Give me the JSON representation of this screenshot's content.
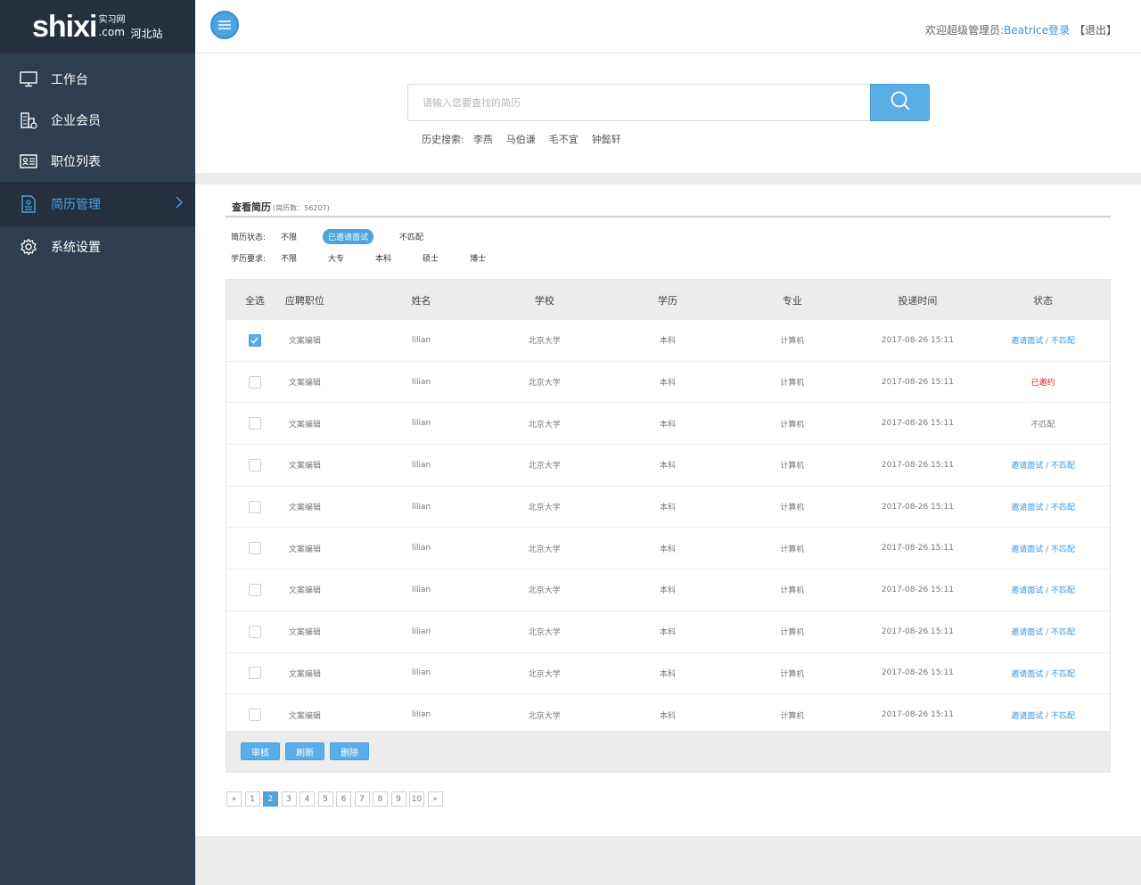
{
  "logo": {
    "main": "shixi",
    "sub_top": "实习网",
    "sub_bottom": ".com",
    "region": "河北站"
  },
  "sidebar": {
    "items": [
      {
        "label": "工作台",
        "icon": "monitor-icon"
      },
      {
        "label": "企业会员",
        "icon": "building-icon"
      },
      {
        "label": "职位列表",
        "icon": "id-card-icon"
      },
      {
        "label": "简历管理",
        "icon": "resume-icon",
        "active": true
      },
      {
        "label": "系统设置",
        "icon": "gear-icon"
      }
    ]
  },
  "header": {
    "welcome_prefix": "欢迎超级管理员:",
    "username": "Beatrice登录",
    "logout": "【退出】"
  },
  "search": {
    "placeholder": "请输入您要查找的简历",
    "history_label": "历史搜索:",
    "history": [
      "李燕",
      "马伯谦",
      "毛不宜",
      "钟懿轩"
    ]
  },
  "section": {
    "title": "查看简历",
    "count": "(简历数：56207)"
  },
  "filters": {
    "status_label": "简历状态:",
    "status_options": [
      "不限",
      "已邀请面试",
      "不匹配"
    ],
    "edu_label": "学历要求:",
    "edu_options": [
      "不限",
      "大专",
      "本科",
      "硕士",
      "博士"
    ]
  },
  "table": {
    "headers": [
      "全选",
      "应聘职位",
      "姓名",
      "学校",
      "学历",
      "专业",
      "投递时间",
      "状态"
    ],
    "rows": [
      {
        "checked": true,
        "position": "文案编辑",
        "name": "lilian",
        "school": "北京大学",
        "edu": "本科",
        "major": "计算机",
        "time": "2017-08-26 15:11",
        "status": "邀请面试 / 不匹配",
        "status_type": "action"
      },
      {
        "checked": false,
        "position": "文案编辑",
        "name": "lilian",
        "school": "北京大学",
        "edu": "本科",
        "major": "计算机",
        "time": "2017-08-26 15:11",
        "status": "已邀约",
        "status_type": "invited"
      },
      {
        "checked": false,
        "position": "文案编辑",
        "name": "lilian",
        "school": "北京大学",
        "edu": "本科",
        "major": "计算机",
        "time": "2017-08-26 15:11",
        "status": "不匹配",
        "status_type": "nomatch"
      },
      {
        "checked": false,
        "position": "文案编辑",
        "name": "lilian",
        "school": "北京大学",
        "edu": "本科",
        "major": "计算机",
        "time": "2017-08-26 15:11",
        "status": "邀请面试 / 不匹配",
        "status_type": "action"
      },
      {
        "checked": false,
        "position": "文案编辑",
        "name": "lilian",
        "school": "北京大学",
        "edu": "本科",
        "major": "计算机",
        "time": "2017-08-26 15:11",
        "status": "邀请面试 / 不匹配",
        "status_type": "action"
      },
      {
        "checked": false,
        "position": "文案编辑",
        "name": "lilian",
        "school": "北京大学",
        "edu": "本科",
        "major": "计算机",
        "time": "2017-08-26 15:11",
        "status": "邀请面试 / 不匹配",
        "status_type": "action"
      },
      {
        "checked": false,
        "position": "文案编辑",
        "name": "lilian",
        "school": "北京大学",
        "edu": "本科",
        "major": "计算机",
        "time": "2017-08-26 15:11",
        "status": "邀请面试 / 不匹配",
        "status_type": "action"
      },
      {
        "checked": false,
        "position": "文案编辑",
        "name": "lilian",
        "school": "北京大学",
        "edu": "本科",
        "major": "计算机",
        "time": "2017-08-26 15:11",
        "status": "邀请面试 / 不匹配",
        "status_type": "action"
      },
      {
        "checked": false,
        "position": "文案编辑",
        "name": "lilian",
        "school": "北京大学",
        "edu": "本科",
        "major": "计算机",
        "time": "2017-08-26 15:11",
        "status": "邀请面试 / 不匹配",
        "status_type": "action"
      },
      {
        "checked": false,
        "position": "文案编辑",
        "name": "lilian",
        "school": "北京大学",
        "edu": "本科",
        "major": "计算机",
        "time": "2017-08-26 15:11",
        "status": "邀请面试 / 不匹配",
        "status_type": "action"
      }
    ]
  },
  "actions": [
    "审核",
    "刷新",
    "删除"
  ],
  "pagination": {
    "prev": "«",
    "next": "»",
    "pages": [
      "1",
      "2",
      "3",
      "4",
      "5",
      "6",
      "7",
      "8",
      "9",
      "10"
    ],
    "current": "2"
  },
  "colors": {
    "sidebar": "#2d3e50",
    "accent": "#4ba3e0",
    "invited": "#e02020"
  }
}
